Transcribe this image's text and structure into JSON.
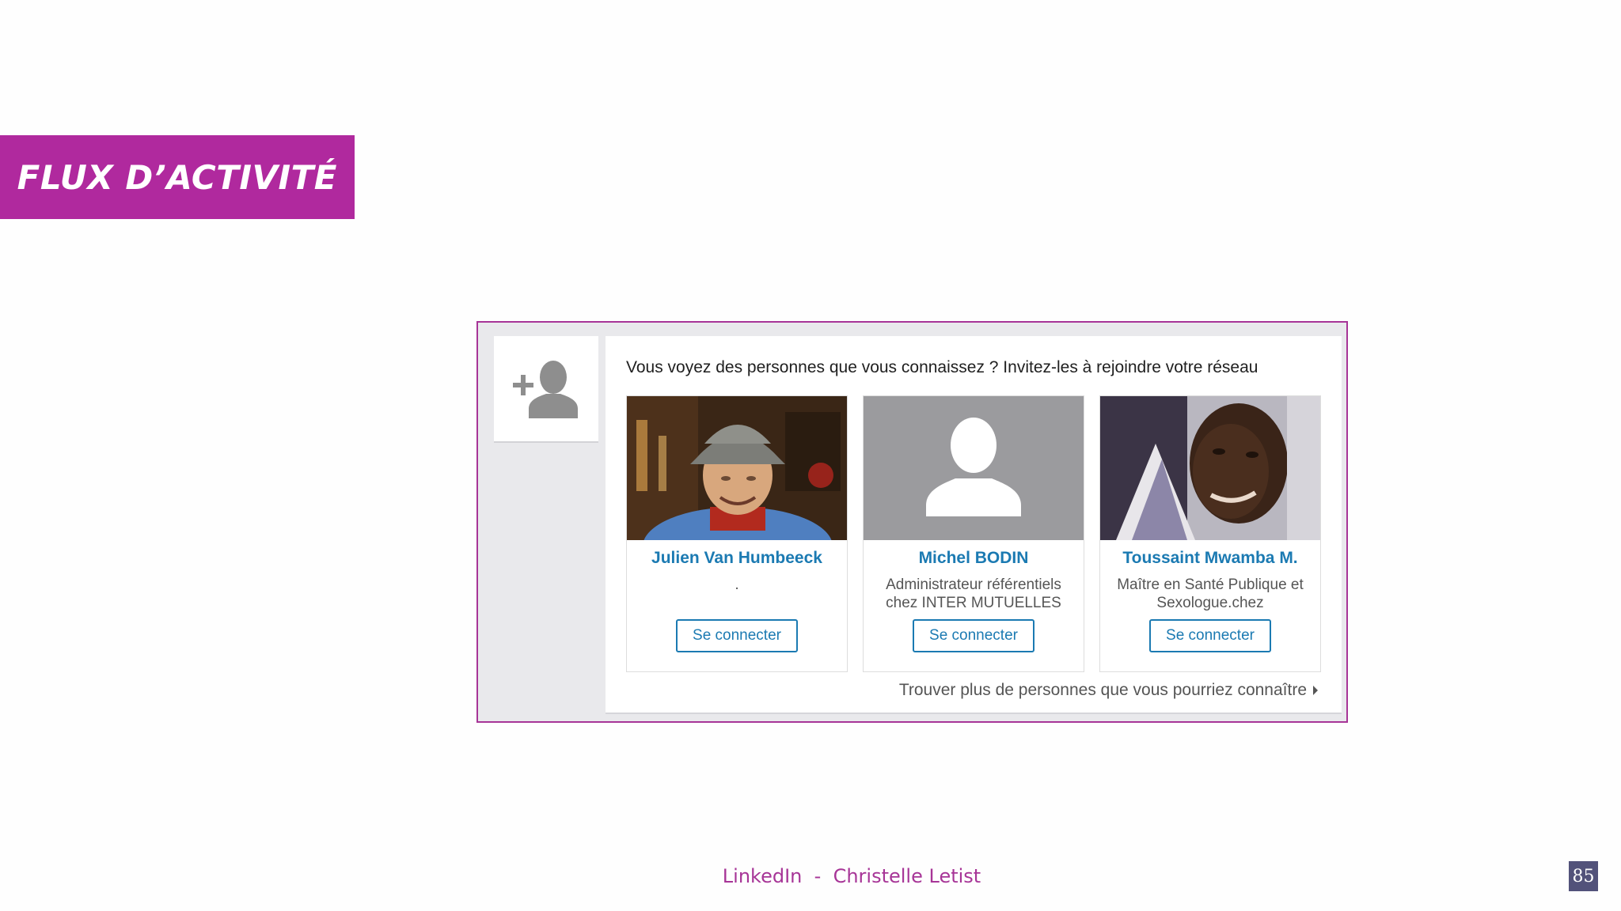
{
  "slide": {
    "title": "FLUX D’ACTIVITÉ",
    "footer": {
      "left": "LinkedIn",
      "separator": "-",
      "right": "Christelle Letist"
    },
    "page_number": "85"
  },
  "widget": {
    "icon": "add-person-icon",
    "prompt": "Vous voyez des personnes que vous connaissez ? Invitez-les à rejoindre votre réseau",
    "cards": [
      {
        "name": "Julien Van Humbeeck",
        "headline": ".",
        "button": "Se connecter"
      },
      {
        "name": "Michel BODIN",
        "headline": "Administrateur référentiels chez INTER MUTUELLES",
        "button": "Se connecter"
      },
      {
        "name": "Toussaint Mwamba M.",
        "headline": "Maître en Santé Publique et Sexologue.chez",
        "button": "Se connecter"
      }
    ],
    "more_link": "Trouver plus de personnes que vous pourriez connaître",
    "colors": {
      "frame": "#a73597",
      "link_blue": "#1b7ab2",
      "title_band": "#b0299e"
    }
  }
}
